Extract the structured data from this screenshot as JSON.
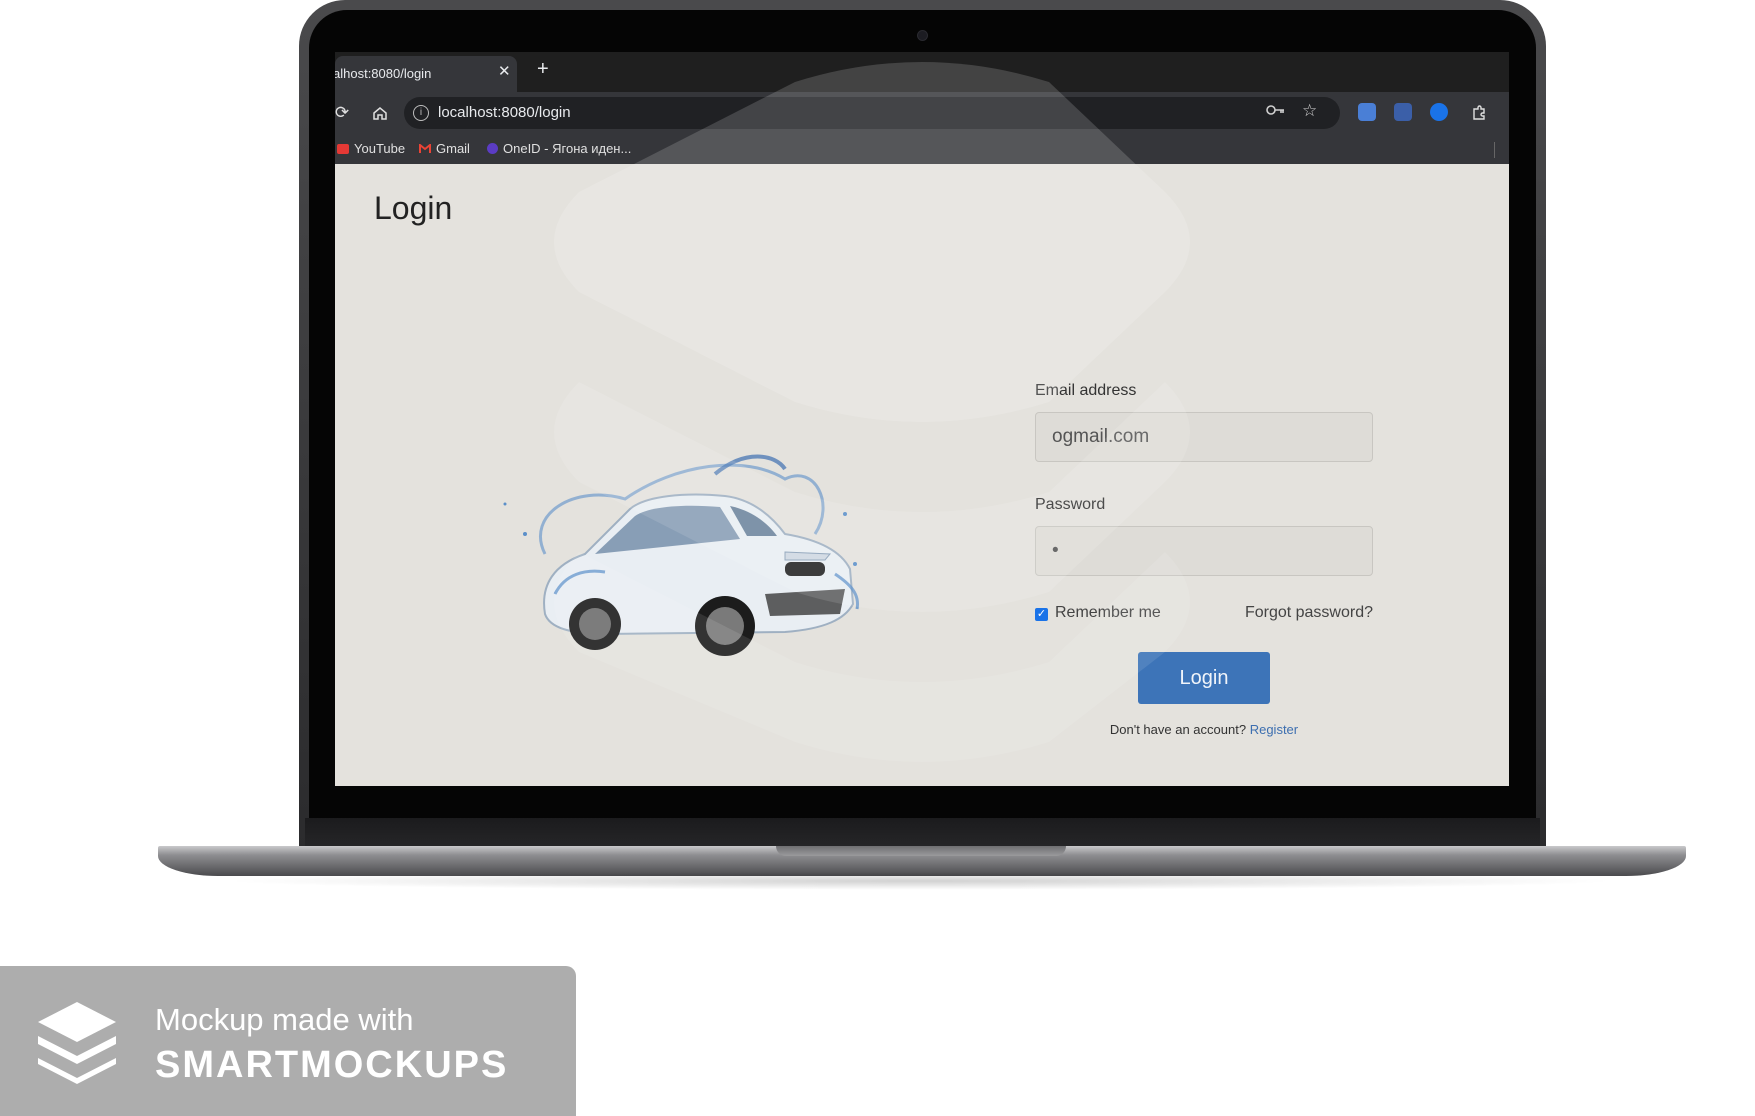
{
  "browser": {
    "tab_title": "alhost:8080/login",
    "tab_close": "✕",
    "new_tab": "+",
    "url": "localhost:8080/login",
    "bookmarks": [
      {
        "label": "YouTube",
        "icon": "youtube-icon"
      },
      {
        "label": "Gmail",
        "icon": "gmail-icon"
      },
      {
        "label": "OneID - Ягона иден...",
        "icon": "oneid-icon"
      }
    ]
  },
  "page": {
    "title": "Login"
  },
  "form": {
    "email_label": "Email address",
    "email_value": "ogmail.com",
    "password_label": "Password",
    "password_value": "•",
    "remember_label": "Remember me",
    "remember_checked": true,
    "forgot_label": "Forgot password?",
    "login_button": "Login",
    "no_account_text": "Don't have an account?",
    "register_link": "Register"
  },
  "badge": {
    "line1": "Mockup made with",
    "line2": "SMARTMOCKUPS"
  },
  "colors": {
    "login_button": "#3d74b8",
    "register_link": "#3d6fb0",
    "page_background": "#e4e2dd",
    "badge_background": "#adadad"
  }
}
